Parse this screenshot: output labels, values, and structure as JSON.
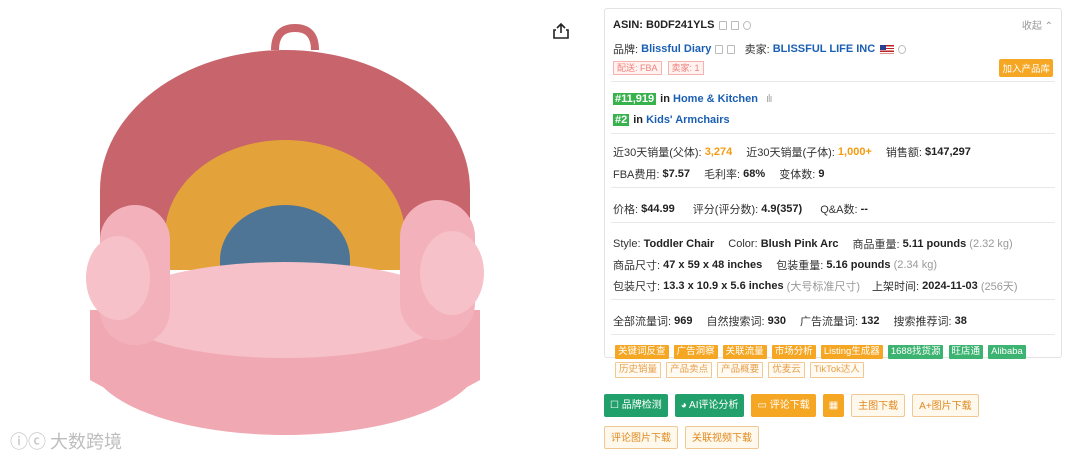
{
  "watermark": "大数跨境",
  "panel": {
    "collapse": "收起",
    "asin_label": "ASIN:",
    "asin": "B0DF241YLS",
    "brand_label": "品牌:",
    "brand": "Blissful Diary",
    "seller_label": "卖家:",
    "seller": "BLISSFUL LIFE INC",
    "tag_fba": "配送: FBA",
    "tag_seller": "卖家: 1",
    "add_button": "加入产品库",
    "rank1": "#11,919",
    "rank1_in": "in",
    "rank1_cat": "Home & Kitchen",
    "rank2": "#2",
    "rank2_in": "in",
    "rank2_cat": "Kids' Armchairs",
    "sales_parent_label": "近30天销量(父体):",
    "sales_parent": "3,274",
    "sales_child_label": "近30天销量(子体):",
    "sales_child": "1,000+",
    "revenue_label": "销售额:",
    "revenue": "$147,297",
    "fba_label": "FBA费用:",
    "fba": "$7.57",
    "margin_label": "毛利率:",
    "margin": "68%",
    "variants_label": "变体数:",
    "variants": "9",
    "price_label": "价格:",
    "price": "$44.99",
    "rating_label": "评分(评分数):",
    "rating": "4.9(357)",
    "qa_label": "Q&A数:",
    "qa": "--",
    "style_label": "Style:",
    "style": "Toddler Chair",
    "color_label": "Color:",
    "color": "Blush Pink Arc",
    "weight_label": "商品重量:",
    "weight": "5.11 pounds",
    "weight_kg": "(2.32 kg)",
    "dim_label": "商品尺寸:",
    "dim": "47 x 59 x 48 inches",
    "pkg_weight_label": "包装重量:",
    "pkg_weight": "5.16 pounds",
    "pkg_weight_kg": "(2.34 kg)",
    "pkg_dim_label": "包装尺寸:",
    "pkg_dim": "13.3 x 10.9 x 5.6 inches",
    "pkg_dim_note": "(大号标准尺寸)",
    "listed_label": "上架时间:",
    "listed": "2024-11-03",
    "listed_days": "(256天)",
    "traffic_label": "全部流量词:",
    "traffic": "969",
    "organic_label": "自然搜索词:",
    "organic": "930",
    "ad_label": "广告流量词:",
    "ad": "132",
    "rec_label": "搜索推荐词:",
    "rec": "38"
  },
  "tags": [
    "关键词反查",
    "广告洞察",
    "关联流量",
    "市场分析",
    "Listing生成器",
    "1688找货源",
    "旺店通",
    "Alibaba",
    "历史销量",
    "产品卖点",
    "产品概要",
    "优麦云",
    "TikTok达人"
  ],
  "buttons": {
    "brand_check": "品牌检测",
    "ai_review": "AI评论分析",
    "review_download": "评论下载",
    "main_image_download": "主图下载",
    "aplus_download": "A+图片下载",
    "review_image_download": "评论图片下载",
    "related_video_download": "关联视频下载"
  }
}
